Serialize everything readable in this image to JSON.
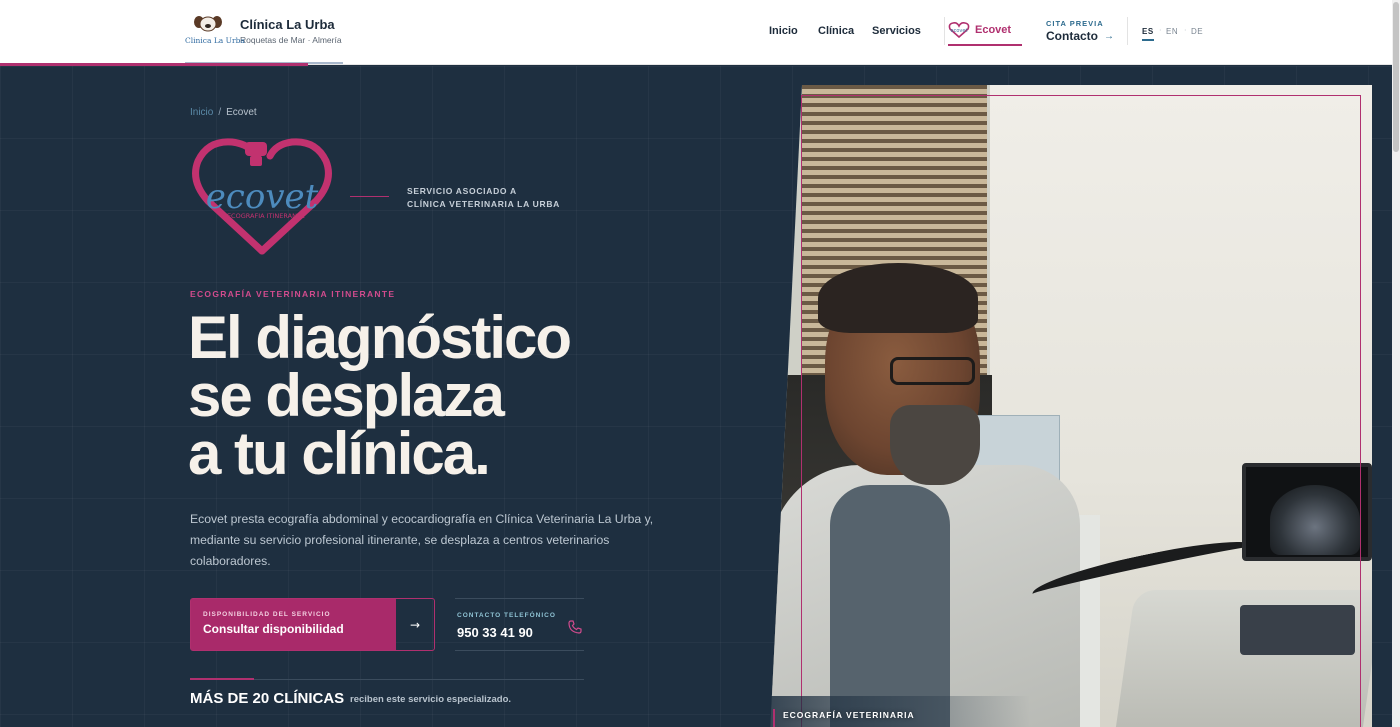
{
  "header": {
    "brand_title": "Clínica La Urba",
    "brand_subtitle": "Roquetas de Mar · Almería",
    "logo_caption": "Clinica La Urba",
    "nav": [
      "Inicio",
      "Clínica",
      "Servicios"
    ],
    "ecovet_label": "Ecovet",
    "cita_eyebrow": "CITA PREVIA",
    "cita_label": "Contacto",
    "languages": [
      "ES",
      "EN",
      "DE"
    ],
    "active_language": "ES"
  },
  "hero": {
    "breadcrumb": [
      "Inicio",
      "Ecovet"
    ],
    "logo_word": "ecovet",
    "logo_tagline": "ECOGRAFIA ITINERANTE",
    "associated_note_line1": "SERVICIO ASOCIADO A",
    "associated_note_line2": "CLÍNICA VETERINARIA LA URBA",
    "eyebrow": "ECOGRAFÍA VETERINARIA ITINERANTE",
    "headline": [
      "El diagnóstico",
      "se desplaza",
      "a tu clínica."
    ],
    "lead": "Ecovet presta ecografía abdominal y ecocardiografía en Clínica Veterinaria La Urba y, mediante su servicio profesional itinerante, se desplaza a centros veterinarios colaboradores.",
    "cta": {
      "eyebrow": "DISPONIBILIDAD DEL SERVICIO",
      "label": "Consultar disponibilidad"
    },
    "phone": {
      "eyebrow": "CONTACTO TELEFÓNICO",
      "number": "950 33 41 90"
    },
    "stat": {
      "big": "MÁS DE 20 CLÍNICAS",
      "small": "reciben este servicio especializado."
    },
    "photo_caption": "ECOGRAFÍA VETERINARIA"
  },
  "colors": {
    "accent": "#b0306f",
    "hero_background": "#1e2f40",
    "brand_blue": "#2d6b8e"
  },
  "icons": [
    "dog-logo-icon",
    "ecovet-heart-icon",
    "arrow-right-icon",
    "phone-icon"
  ]
}
